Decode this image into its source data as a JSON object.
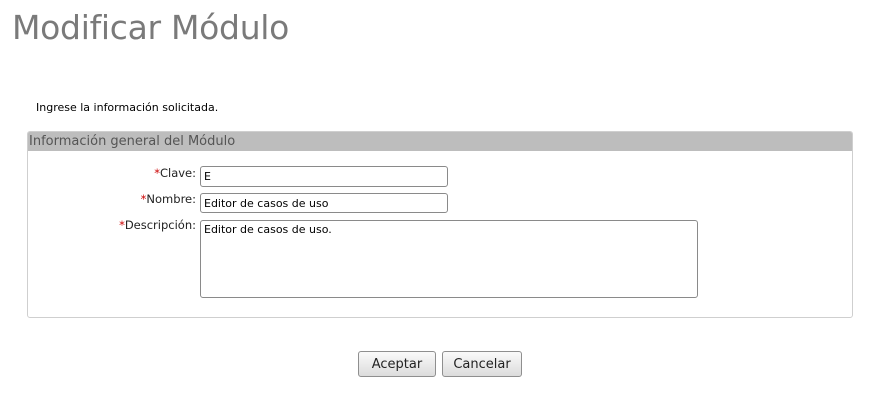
{
  "page": {
    "title": "Modificar Módulo",
    "instructions": "Ingrese la información solicitada."
  },
  "panel": {
    "header": "Información general del Módulo"
  },
  "form": {
    "required_marker": "*",
    "clave": {
      "label": "Clave:",
      "value": "E"
    },
    "nombre": {
      "label": "Nombre:",
      "value": "Editor de casos de uso"
    },
    "descripcion": {
      "label": "Descripción:",
      "value": "Editor de casos de uso."
    }
  },
  "buttons": {
    "accept": "Aceptar",
    "cancel": "Cancelar"
  },
  "colors": {
    "title": "#7a7a7a",
    "panel_header_bg": "#bdbdbd",
    "required": "#cc0000"
  }
}
